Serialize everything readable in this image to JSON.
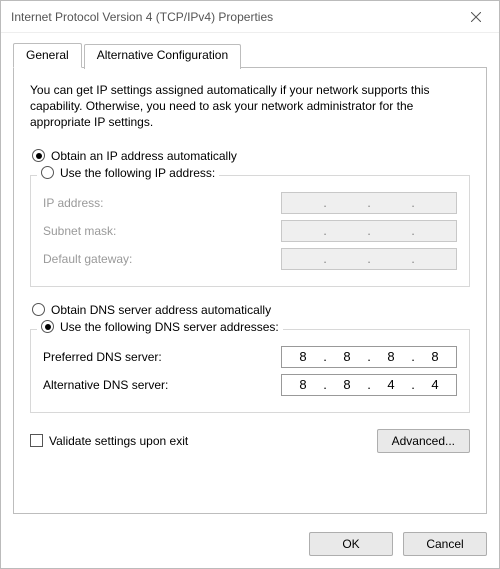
{
  "window": {
    "title": "Internet Protocol Version 4 (TCP/IPv4) Properties"
  },
  "tabs": {
    "general": "General",
    "alt": "Alternative Configuration"
  },
  "intro": "You can get IP settings assigned automatically if your network supports this capability. Otherwise, you need to ask your network administrator for the appropriate IP settings.",
  "ip": {
    "auto_label": "Obtain an IP address automatically",
    "manual_label": "Use the following IP address:",
    "ip_label": "IP address:",
    "subnet_label": "Subnet mask:",
    "gateway_label": "Default gateway:",
    "ip_value": [
      "",
      "",
      "",
      ""
    ],
    "subnet_value": [
      "",
      "",
      "",
      ""
    ],
    "gateway_value": [
      "",
      "",
      "",
      ""
    ]
  },
  "dns": {
    "auto_label": "Obtain DNS server address automatically",
    "manual_label": "Use the following DNS server addresses:",
    "preferred_label": "Preferred DNS server:",
    "alternate_label": "Alternative DNS server:",
    "preferred_value": [
      "8",
      "8",
      "8",
      "8"
    ],
    "alternate_value": [
      "8",
      "8",
      "4",
      "4"
    ]
  },
  "validate_label": "Validate settings upon exit",
  "buttons": {
    "advanced": "Advanced...",
    "ok": "OK",
    "cancel": "Cancel"
  }
}
